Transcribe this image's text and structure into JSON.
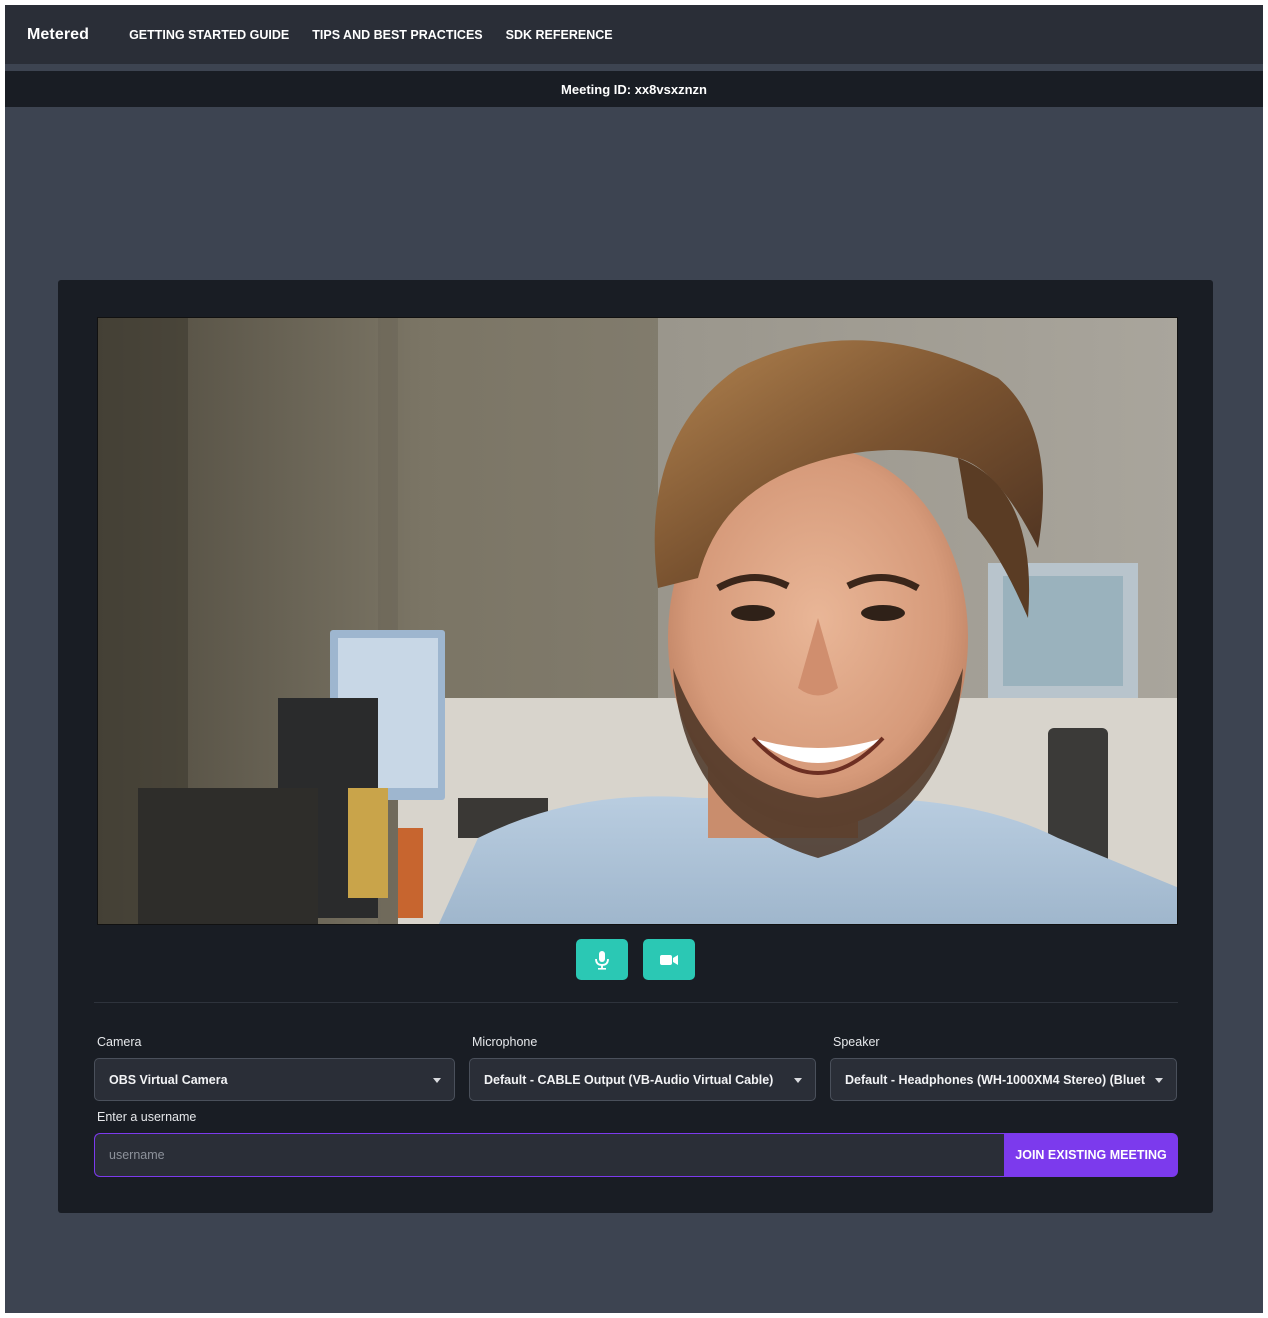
{
  "nav": {
    "brand": "Metered",
    "links": [
      "GETTING STARTED GUIDE",
      "TIPS AND BEST PRACTICES",
      "SDK REFERENCE"
    ]
  },
  "meeting": {
    "id_text": "Meeting ID: xx8vsxznzn"
  },
  "preview": {
    "video_content": "camera preview of smiling man"
  },
  "controls": {
    "mic_icon": "microphone-icon",
    "camera_icon": "video-camera-icon",
    "accent_color": "#2bc8b4"
  },
  "devices": {
    "camera": {
      "label": "Camera",
      "value": "OBS Virtual Camera"
    },
    "microphone": {
      "label": "Microphone",
      "value": "Default - CABLE Output (VB-Audio Virtual Cable)"
    },
    "speaker": {
      "label": "Speaker",
      "value": "Default - Headphones (WH-1000XM4 Stereo) (Bluet"
    }
  },
  "username": {
    "label": "Enter a username",
    "placeholder": "username",
    "value": ""
  },
  "join": {
    "label": "JOIN EXISTING MEETING",
    "color": "#7c3aed"
  }
}
